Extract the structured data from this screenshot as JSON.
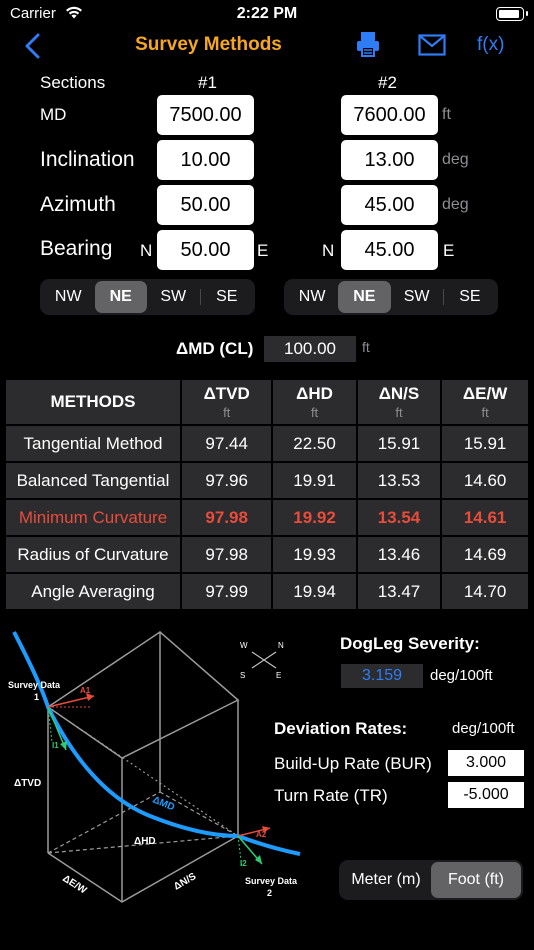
{
  "status": {
    "carrier": "Carrier",
    "time": "2:22 PM"
  },
  "nav": {
    "title": "Survey Methods",
    "fx": "f(x)"
  },
  "sections": {
    "label": "Sections",
    "col1": "#1",
    "col2": "#2",
    "md": {
      "label": "MD",
      "v1": "7500.00",
      "v2": "7600.00",
      "unit": "ft"
    },
    "inclination": {
      "label": "Inclination",
      "v1": "10.00",
      "v2": "13.00",
      "unit": "deg"
    },
    "azimuth": {
      "label": "Azimuth",
      "v1": "50.00",
      "v2": "45.00",
      "unit": "deg"
    },
    "bearing": {
      "label": "Bearing",
      "ns1": "N",
      "v1": "50.00",
      "ew1": "E",
      "ns2": "N",
      "v2": "45.00",
      "ew2": "E"
    }
  },
  "quadrant1": {
    "options": [
      "NW",
      "NE",
      "SW",
      "SE"
    ],
    "selected": "NE"
  },
  "quadrant2": {
    "options": [
      "NW",
      "NE",
      "SW",
      "SE"
    ],
    "selected": "NE"
  },
  "dmd": {
    "label": "ΔMD (CL)",
    "value": "100.00",
    "unit": "ft"
  },
  "table": {
    "headers": [
      {
        "label": "METHODS",
        "unit": ""
      },
      {
        "label": "ΔTVD",
        "unit": "ft"
      },
      {
        "label": "ΔHD",
        "unit": "ft"
      },
      {
        "label": "ΔN/S",
        "unit": "ft"
      },
      {
        "label": "ΔE/W",
        "unit": "ft"
      }
    ],
    "rows": [
      {
        "name": "Tangential Method",
        "tvd": "97.44",
        "hd": "22.50",
        "ns": "15.91",
        "ew": "15.91"
      },
      {
        "name": "Balanced Tangential",
        "tvd": "97.96",
        "hd": "19.91",
        "ns": "13.53",
        "ew": "14.60"
      },
      {
        "name": "Minimum Curvature",
        "tvd": "97.98",
        "hd": "19.92",
        "ns": "13.54",
        "ew": "14.61"
      },
      {
        "name": "Radius of Curvature",
        "tvd": "97.98",
        "hd": "19.93",
        "ns": "13.46",
        "ew": "14.69"
      },
      {
        "name": "Angle Averaging",
        "tvd": "97.99",
        "hd": "19.94",
        "ns": "13.47",
        "ew": "14.70"
      }
    ],
    "highlight_row": 2,
    "highlight_color": "#e74c3c"
  },
  "diagram": {
    "survey1": "Survey Data",
    "survey1_num": "1",
    "survey2": "Survey Data",
    "survey2_num": "2",
    "a1": "A1",
    "a2": "A2",
    "i1": "I1",
    "i2": "I2",
    "dtvd": "ΔTVD",
    "dmd": "ΔMD",
    "dhd": "ΔHD",
    "dew": "ΔE/W",
    "dns": "ΔN/S",
    "compass": {
      "w": "W",
      "n": "N",
      "s": "S",
      "e": "E"
    }
  },
  "dogleg": {
    "title": "DogLeg Severity:",
    "value": "3.159",
    "unit": "deg/100ft"
  },
  "deviation": {
    "title": "Deviation Rates:",
    "unit": "deg/100ft",
    "bur_label": "Build-Up Rate (BUR)",
    "bur_value": "3.000",
    "tr_label": "Turn Rate (TR)",
    "tr_value": "-5.000"
  },
  "units": {
    "options": [
      "Meter (m)",
      "Foot (ft)"
    ],
    "selected": "Foot (ft)"
  },
  "colors": {
    "accent_orange": "#f5a623",
    "accent_blue": "#2f7df6",
    "curve_blue": "#1e9bff",
    "red": "#e74c3c"
  }
}
